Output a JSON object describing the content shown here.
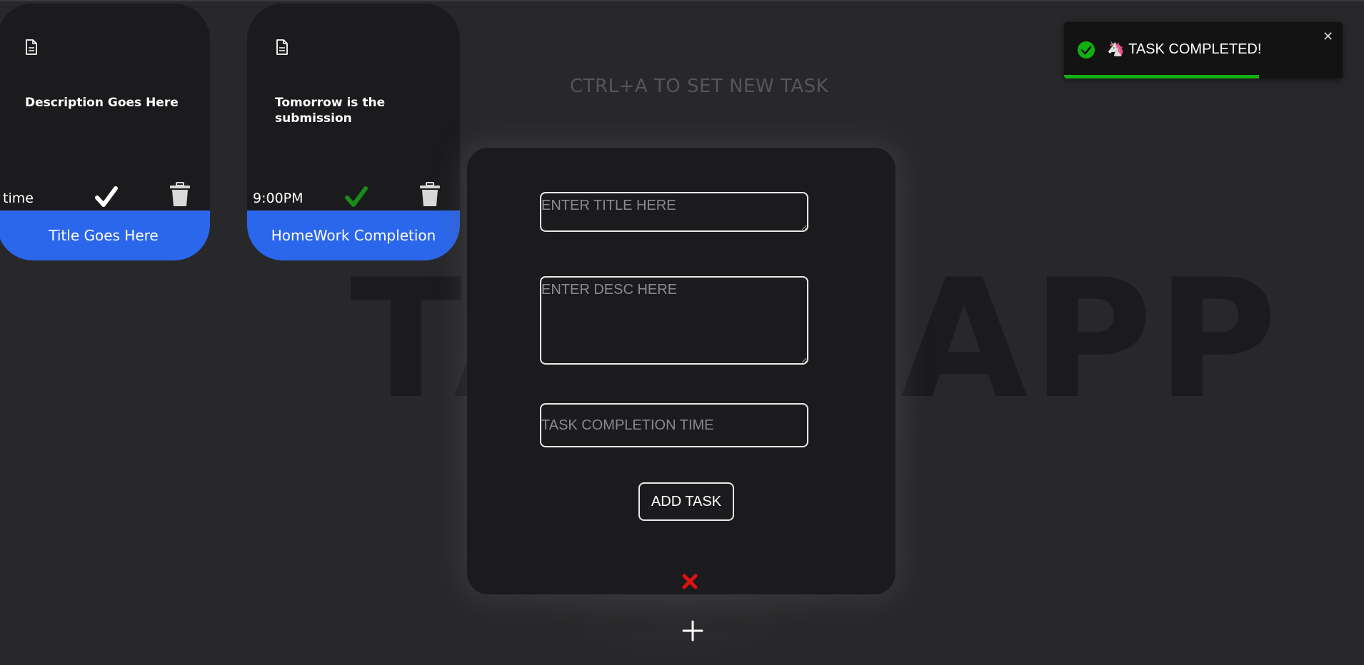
{
  "background_heading": "TASK APP",
  "hint": "CTRL+A TO SET NEW TASK",
  "cards": [
    {
      "description": "Description Goes Here",
      "time": "time",
      "title": "Title Goes Here",
      "completed": false
    },
    {
      "description": "Tomorrow is the submission",
      "time": "9:00PM",
      "title": "HomeWork Completion",
      "completed": true
    }
  ],
  "modal": {
    "title_placeholder": "ENTER TITLE HERE",
    "desc_placeholder": "ENTER DESC HERE",
    "time_placeholder": "TASK COMPLETION TIME",
    "add_button": "ADD TASK"
  },
  "toast": {
    "message": "🦄 TASK COMPLETED!",
    "close": "✕",
    "progress": 0.7
  },
  "colors": {
    "card_title_bar": "#2b67ed",
    "completed_check": "#1a8a1a",
    "toast_success": "#10b010",
    "close_red": "#e01010"
  },
  "icons": {
    "card_doc": "document-icon",
    "check": "check-icon",
    "trash": "trash-icon",
    "modal_close": "close-icon",
    "add": "plus-icon",
    "toast_ok": "success-icon"
  }
}
